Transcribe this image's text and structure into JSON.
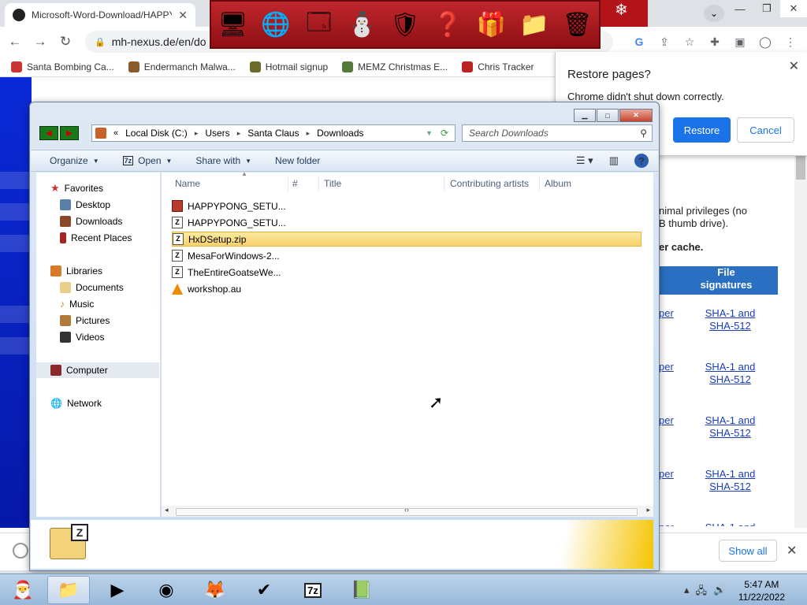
{
  "browser": {
    "tab_title": "Microsoft-Word-Download/HAPPY",
    "url": "mh-nexus.de/en/do",
    "bookmarks": [
      {
        "label": "Santa Bombing Ca...",
        "color": "#c33"
      },
      {
        "label": "Endermanch Malwa...",
        "color": "#8a5a2a"
      },
      {
        "label": "Hotmail signup",
        "color": "#6b6b2a"
      },
      {
        "label": "MEMZ Christmas E...",
        "color": "#557a3a"
      },
      {
        "label": "Chris Tracker",
        "color": "#b22"
      }
    ]
  },
  "restore_popup": {
    "title": "Restore pages?",
    "subtitle": "Chrome didn't shut down correctly.",
    "restore_label": "Restore",
    "cancel_label": "Cancel"
  },
  "webpage": {
    "text1": "nimal privileges (no",
    "text2": "B thumb drive).",
    "text3": "er cache.",
    "table_header": [
      "File",
      "signatures"
    ],
    "rows": [
      {
        "left": "per",
        "sig1": "SHA-1 and",
        "sig2": "SHA-512"
      },
      {
        "left": "per",
        "sig1": "SHA-1 and",
        "sig2": "SHA-512"
      },
      {
        "left": "per",
        "sig1": "SHA-1 and",
        "sig2": "SHA-512"
      },
      {
        "left": "per",
        "sig1": "SHA-1 and",
        "sig2": "SHA-512"
      },
      {
        "left": "per",
        "sig1": "SHA-1 and",
        "sig2": ""
      }
    ]
  },
  "downloads_bar": {
    "show_all": "Show all"
  },
  "explorer": {
    "breadcrumb": [
      "Local Disk (C:)",
      "Users",
      "Santa Claus",
      "Downloads"
    ],
    "search_placeholder": "Search Downloads",
    "commands": {
      "organize": "Organize",
      "open": "Open",
      "share": "Share with",
      "new_folder": "New folder"
    },
    "nav": {
      "favorites": "Favorites",
      "desktop": "Desktop",
      "downloads": "Downloads",
      "recent": "Recent Places",
      "libraries": "Libraries",
      "documents": "Documents",
      "music": "Music",
      "pictures": "Pictures",
      "videos": "Videos",
      "computer": "Computer",
      "network": "Network"
    },
    "columns": {
      "name": "Name",
      "num": "#",
      "title": "Title",
      "artists": "Contributing artists",
      "album": "Album"
    },
    "files": [
      {
        "name": "HAPPYPONG_SETU...",
        "icon": "installer"
      },
      {
        "name": "HAPPYPONG_SETU...",
        "icon": "7z"
      },
      {
        "name": "HxDSetup.zip",
        "icon": "7z",
        "selected": true
      },
      {
        "name": "MesaForWindows-2...",
        "icon": "7z"
      },
      {
        "name": "TheEntireGoatseWe...",
        "icon": "7z"
      },
      {
        "name": "workshop.au",
        "icon": "vlc"
      }
    ]
  },
  "taskbar": {
    "time": "5:47 AM",
    "date": "11/22/2022"
  }
}
